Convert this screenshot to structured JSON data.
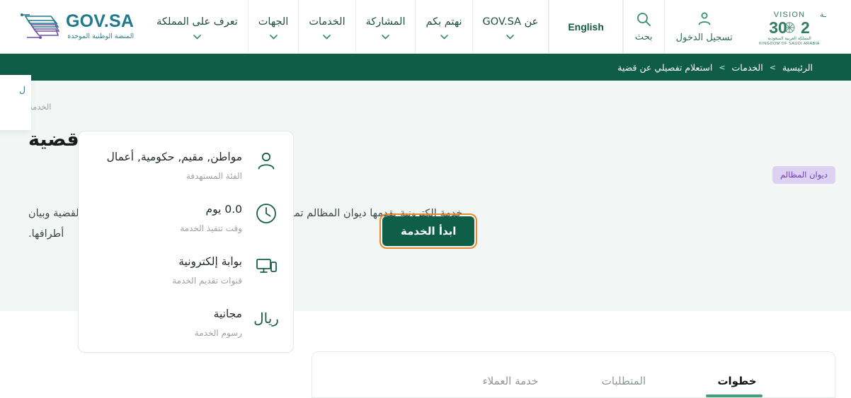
{
  "header": {
    "brand": {
      "logo_title": "GOV.SA",
      "logo_subtitle": "المنصة الوطنية الموحدة"
    },
    "nav_items": [
      {
        "label": "تعرف على المملكة",
        "has_chevron": true
      },
      {
        "label": "الجهات",
        "has_chevron": true
      },
      {
        "label": "الخدمات",
        "has_chevron": true
      },
      {
        "label": "المشاركة",
        "has_chevron": true
      },
      {
        "label": "نهتم بكم",
        "has_chevron": true
      },
      {
        "label": "عن GOV.SA",
        "has_chevron": true
      }
    ],
    "language_switch": "English",
    "search_label": "بحث",
    "login_label": "تسجيل الدخول",
    "vision_logo": {
      "line1": "VISION",
      "line2_ar": "رؤيـــة",
      "year": "2030",
      "country_ar": "المملكة العربية السعودية",
      "country_en": "KINGDOM OF SAUDI ARABIA"
    }
  },
  "breadcrumb": {
    "items": [
      "الرئيسية",
      "الخدمات",
      "استعلام تفصيلي عن قضية"
    ],
    "separator": ">"
  },
  "side_panel": {
    "glyph": "ل"
  },
  "hero": {
    "service_label": "الخدمة",
    "title": "استعلام تفصيلي عن قضية",
    "agency_badge": "ديوان المظالم",
    "description": "خدمة إلكترونية يقدمها ديوان المظالم تمكن المستفيد من معرفة الإجراءات التي تمت على القضية وبيان أطرافها.",
    "start_button": "ابدأ الخدمة"
  },
  "info_card": {
    "rows": [
      {
        "icon": "user-icon",
        "value": "مواطن, مقيم, حكومية, أعمال",
        "caption": "الفئة المستهدفة"
      },
      {
        "icon": "clock-icon",
        "value": "0.0 يوم",
        "caption": "وقت تنفيذ الخدمة"
      },
      {
        "icon": "devices-icon",
        "value": "بوابة إلكترونية",
        "caption": "قنوات تقديم الخدمة"
      },
      {
        "icon": "riyal-icon",
        "value": "مجانية",
        "caption": "رسوم الخدمة"
      }
    ]
  },
  "tabs": {
    "items": [
      {
        "label": "خطوات",
        "active": true
      },
      {
        "label": "المتطلبات",
        "active": false
      },
      {
        "label": "خدمة العملاء",
        "active": false
      }
    ]
  },
  "colors": {
    "brand_teal": "#1f7a8c",
    "dark_green": "#0f5c47",
    "button_green": "#0f5f48",
    "focus_orange": "#e98a32",
    "badge_bg": "#ddd0f2",
    "badge_text": "#6f42b8",
    "tab_underline": "#44a07a",
    "hero_bg": "#f2f7f5"
  }
}
